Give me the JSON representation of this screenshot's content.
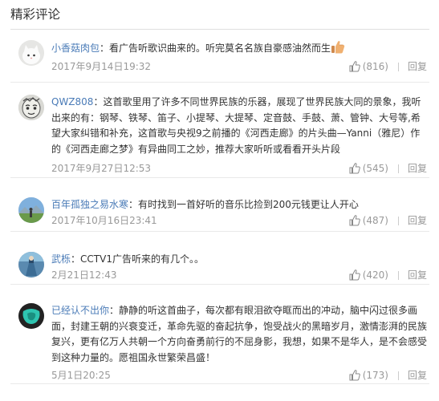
{
  "section_title": "精彩评论",
  "reply_label": "回复",
  "comments": [
    {
      "user": "小香菇肉包",
      "separator": "：",
      "text": "看广告听歌识曲来的。听完莫名名族自豪感油然而生",
      "time": "2017年9月14日19:32",
      "likes": "(816)",
      "avatar_icon": "cat-avatar-icon",
      "emoji_icon": "thumbs-up-emoji-icon"
    },
    {
      "user": "QWZ808",
      "separator": "：",
      "text": "这首歌里用了许多不同世界民族的乐器，展现了世界民族大同的景象，我听出来的有：钢琴、铁琴、笛子、小提琴、大提琴、定音鼓、手鼓、萧、管钟、大号等,希望大家纠错和补充，这首歌与央视9之前播的《河西走廊》的片头曲—Yanni（雅尼）作的《河西走廊之梦》有异曲同工之妙，推荐大家听听或看看开头片段",
      "time": "2017年9月27日12:53",
      "likes": "(545)",
      "avatar_icon": "hand-drawn-face-avatar-icon"
    },
    {
      "user": "百年孤独之易水寒",
      "separator": "：",
      "text": "有时找到一首好听的音乐比捡到200元钱更让人开心",
      "time": "2017年10月16日23:41",
      "likes": "(487)",
      "avatar_icon": "landscape-avatar-icon"
    },
    {
      "user": "武栎",
      "separator": "：",
      "text": "CCTV1广告听来的有几个。。",
      "time": "2月21日12:43",
      "likes": "(420)",
      "avatar_icon": "figure-avatar-icon"
    },
    {
      "user": "已经认不出你",
      "separator": "：",
      "text": "静静的听这首曲子，每次都有眼泪欲夺眶而出的冲动，脑中闪过很多画面，封建王朝的兴衰变迁，革命先驱的奋起抗争，饱受战火的黑暗岁月，激情澎湃的民族复兴，更有亿万人共朝一个方向奋勇前行的不屈身影，我想，如果不是华人，是不会感受到这种力量的。愿祖国永世繁荣昌盛！",
      "time": "5月1日20:25",
      "likes": "(173)",
      "avatar_icon": "teal-shape-avatar-icon"
    }
  ],
  "colors": {
    "username": "#4a7bb7",
    "text": "#333333",
    "meta": "#999999",
    "divider": "#e9e9e9"
  }
}
